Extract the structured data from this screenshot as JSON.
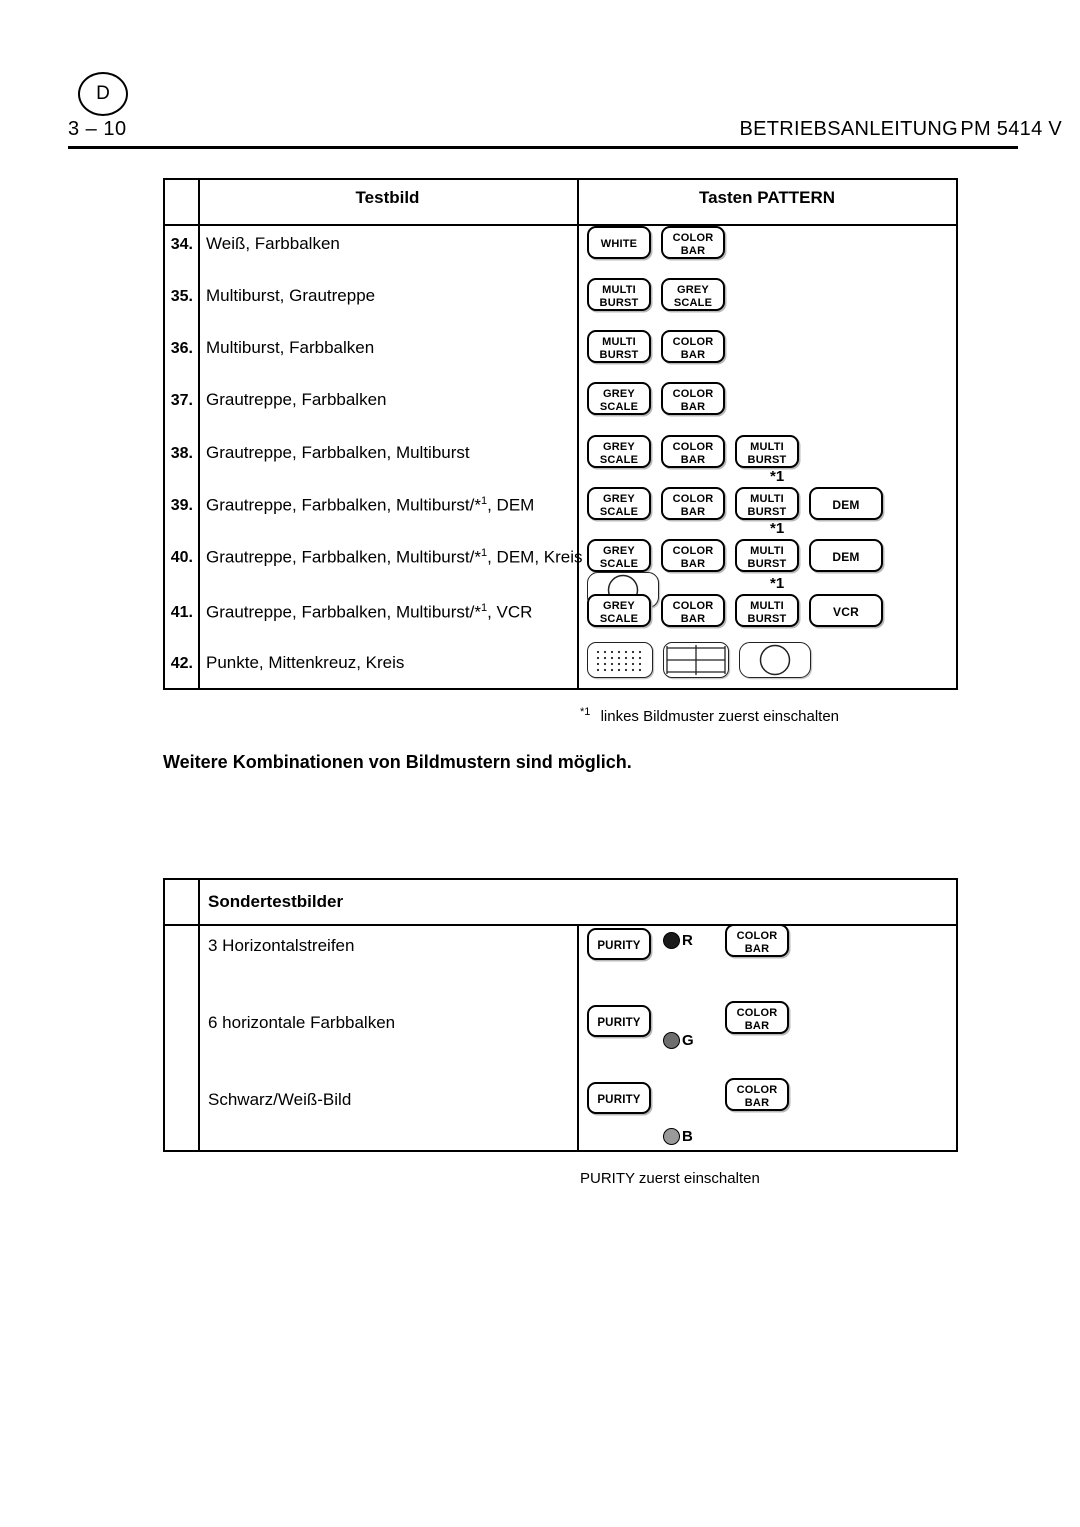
{
  "page": {
    "language_badge": "D",
    "page_number": "3 – 10",
    "doc_title": "BETRIEBSANLEITUNG",
    "doc_model": "PM 5414 V"
  },
  "table1": {
    "headers": {
      "number": "",
      "testbild": "Testbild",
      "tasten": "Tasten PATTERN"
    },
    "rows": [
      {
        "num": "34.",
        "label": "Weiß, Farbbalken",
        "keys": [
          "WHITE",
          "COLOR BAR"
        ],
        "star": false
      },
      {
        "num": "35.",
        "label": "Multiburst, Grautreppe",
        "keys": [
          "MULTI BURST",
          "GREY SCALE"
        ],
        "star": false
      },
      {
        "num": "36.",
        "label": "Multiburst, Farbbalken",
        "keys": [
          "MULTI BURST",
          "COLOR BAR"
        ],
        "star": false
      },
      {
        "num": "37.",
        "label": "Grautreppe, Farbbalken",
        "keys": [
          "GREY SCALE",
          "COLOR BAR"
        ],
        "star": false
      },
      {
        "num": "38.",
        "label": "Grautreppe, Farbbalken, Multiburst",
        "keys": [
          "GREY SCALE",
          "COLOR BAR",
          "MULTI BURST"
        ],
        "star": false
      },
      {
        "num": "39.",
        "label_pre": "Grautreppe, Farbbalken, Multiburst/*",
        "label_sup": "1",
        "label_post": ", DEM",
        "keys": [
          "GREY SCALE",
          "COLOR BAR",
          "MULTI BURST",
          "DEM"
        ],
        "star": true,
        "star_label": "*1"
      },
      {
        "num": "40.",
        "label_pre": "Grautreppe, Farbbalken, Multiburst/*",
        "label_sup": "1",
        "label_post": ", DEM, Kreis",
        "keys": [
          "GREY SCALE",
          "COLOR BAR",
          "MULTI BURST",
          "DEM",
          "circle-icon"
        ],
        "star": true,
        "star_label": "*1"
      },
      {
        "num": "41.",
        "label_pre": "Grautreppe, Farbbalken, Multiburst/*",
        "label_sup": "1",
        "label_post": ", VCR",
        "keys": [
          "GREY SCALE",
          "COLOR BAR",
          "MULTI BURST",
          "VCR"
        ],
        "star": true,
        "star_label": "*1"
      },
      {
        "num": "42.",
        "label": "Punkte, Mittenkreuz, Kreis",
        "keys": [
          "dots-icon",
          "crosshair-icon",
          "circle-icon"
        ],
        "star": false
      }
    ],
    "footnote_marker": "*1",
    "footnote_text": "linkes Bildmuster zuerst einschalten"
  },
  "bold_note": "Weitere Kombinationen von Bildmustern sind möglich.",
  "table2": {
    "header": "Sondertestbilder",
    "rows": [
      {
        "label": "3 Horizontalstreifen",
        "purity": "PURITY",
        "led_letter": "R",
        "led_color": "#1a1a1a",
        "color_bar": "COLOR BAR"
      },
      {
        "label": "6 horizontale Farbbalken",
        "purity": "PURITY",
        "led_letter": "G",
        "led_color": "#6e6e6e",
        "color_bar": "COLOR BAR"
      },
      {
        "label": "Schwarz/Weiß-Bild",
        "purity": "PURITY",
        "led_letter": "B",
        "led_color": "#9a9a9a",
        "color_bar": "COLOR BAR"
      }
    ],
    "footnote_text": "PURITY zuerst einschalten"
  },
  "key_labels": {
    "white": "WHITE",
    "color": "COLOR",
    "bar": "BAR",
    "multi": "MULTI",
    "burst": "BURST",
    "grey": "GREY",
    "scale": "SCALE",
    "dem": "DEM",
    "vcr": "VCR",
    "purity": "PURITY"
  }
}
